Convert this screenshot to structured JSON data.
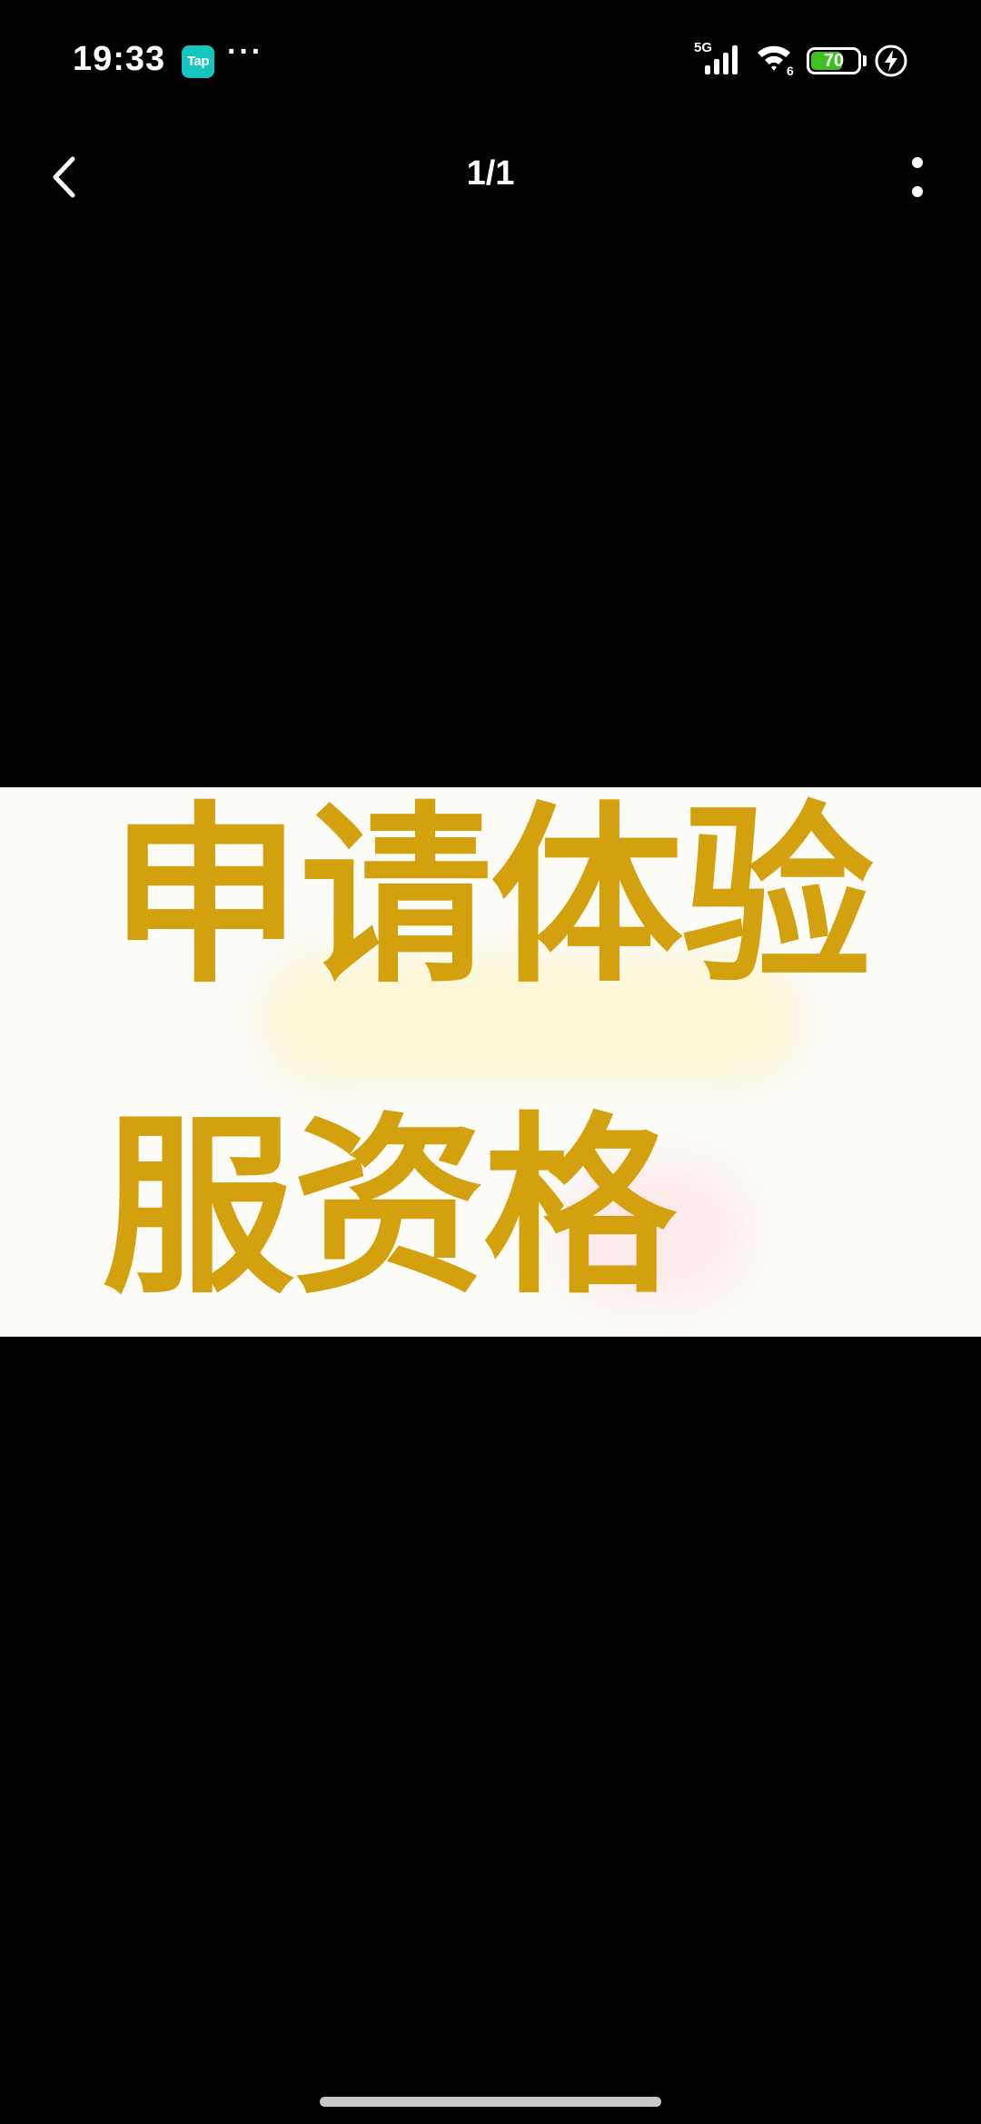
{
  "status_bar": {
    "time": "19:33",
    "app_badge": "Tap",
    "more_indicator": "···",
    "network": "5G",
    "wifi_sub": "6",
    "battery_level": 70,
    "battery_text": "70",
    "icons": [
      "tap-app-icon",
      "signal-icon",
      "wifi-icon",
      "battery-icon",
      "charging-icon"
    ],
    "battery_color": "#3ec11f",
    "tap_badge_color": "#17c5bf"
  },
  "header": {
    "back_icon": "chevron-left-icon",
    "page_counter": "1/1",
    "more_icon": "vertical-dots-icon"
  },
  "image": {
    "line1": "申请体验",
    "line2": "服资格",
    "text_color": "#d4a10e",
    "background": "#fdfcf8"
  }
}
